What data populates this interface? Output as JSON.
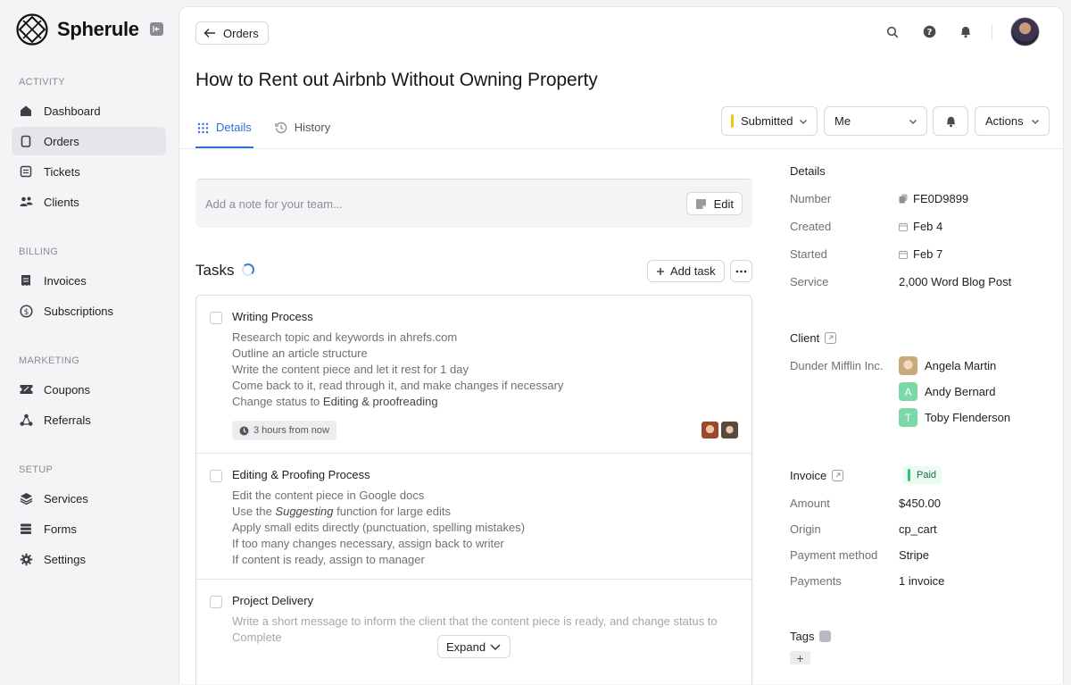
{
  "brand": {
    "name": "Spherule"
  },
  "sidebar": {
    "sections": [
      {
        "title": "ACTIVITY",
        "items": [
          {
            "label": "Dashboard",
            "icon": "home-icon"
          },
          {
            "label": "Orders",
            "icon": "clipboard-icon",
            "active": true
          },
          {
            "label": "Tickets",
            "icon": "ticket-icon"
          },
          {
            "label": "Clients",
            "icon": "users-icon"
          }
        ]
      },
      {
        "title": "BILLING",
        "items": [
          {
            "label": "Invoices",
            "icon": "invoice-icon"
          },
          {
            "label": "Subscriptions",
            "icon": "dollar-circle-icon"
          }
        ]
      },
      {
        "title": "MARKETING",
        "items": [
          {
            "label": "Coupons",
            "icon": "coupon-icon"
          },
          {
            "label": "Referrals",
            "icon": "referral-icon"
          }
        ]
      },
      {
        "title": "SETUP",
        "items": [
          {
            "label": "Services",
            "icon": "layers-icon"
          },
          {
            "label": "Forms",
            "icon": "forms-icon"
          },
          {
            "label": "Settings",
            "icon": "gear-icon"
          }
        ]
      }
    ]
  },
  "header": {
    "back_label": "Orders",
    "title": "How to Rent out Airbnb Without Owning Property",
    "tabs": [
      {
        "label": "Details",
        "active": true
      },
      {
        "label": "History"
      }
    ],
    "status": {
      "label": "Submitted",
      "color": "#f1c40f"
    },
    "assignee": "Me",
    "actions_label": "Actions"
  },
  "note": {
    "placeholder": "Add a note for your team...",
    "edit_label": "Edit"
  },
  "tasks": {
    "title": "Tasks",
    "add_label": "Add task",
    "expand_label": "Expand",
    "items": [
      {
        "title": "Writing Process",
        "lines": [
          "Research topic and keywords in ahrefs.com",
          "Outline an article structure",
          "Write the content piece and let it rest for 1 day",
          "Come back to it, read through it, and make changes if necessary"
        ],
        "status_line_prefix": "Change status to ",
        "status_line_value": "Editing & proofreading",
        "due": "3 hours from now"
      },
      {
        "title": "Editing & Proofing Process",
        "lines": [
          "Edit the content piece in Google docs"
        ],
        "suggest_prefix": "Use the ",
        "suggest_em": "Suggesting",
        "suggest_suffix": " function for large edits",
        "lines2": [
          "Apply small edits directly (punctuation, spelling mistakes)",
          "If too many changes necessary, assign back to writer",
          "If content is ready, assign to manager"
        ]
      },
      {
        "title": "Project Delivery",
        "lines": [
          "Write a short message to inform the client that the content piece is ready, and change status to",
          "Complete"
        ]
      }
    ]
  },
  "details": {
    "title": "Details",
    "number_label": "Number",
    "number": "FE0D9899",
    "created_label": "Created",
    "created": "Feb 4",
    "started_label": "Started",
    "started": "Feb 7",
    "service_label": "Service",
    "service": "2,000 Word Blog Post"
  },
  "client": {
    "title": "Client",
    "company": "Dunder Mifflin Inc.",
    "people": [
      {
        "name": "Angela Martin",
        "initial": ""
      },
      {
        "name": "Andy Bernard",
        "initial": "A"
      },
      {
        "name": "Toby Flenderson",
        "initial": "T"
      }
    ]
  },
  "invoice": {
    "title": "Invoice",
    "status": "Paid",
    "amount_label": "Amount",
    "amount": "$450.00",
    "origin_label": "Origin",
    "origin": "cp_cart",
    "method_label": "Payment method",
    "method": "Stripe",
    "payments_label": "Payments",
    "payments": "1 invoice"
  },
  "tags": {
    "title": "Tags",
    "add": "+"
  }
}
